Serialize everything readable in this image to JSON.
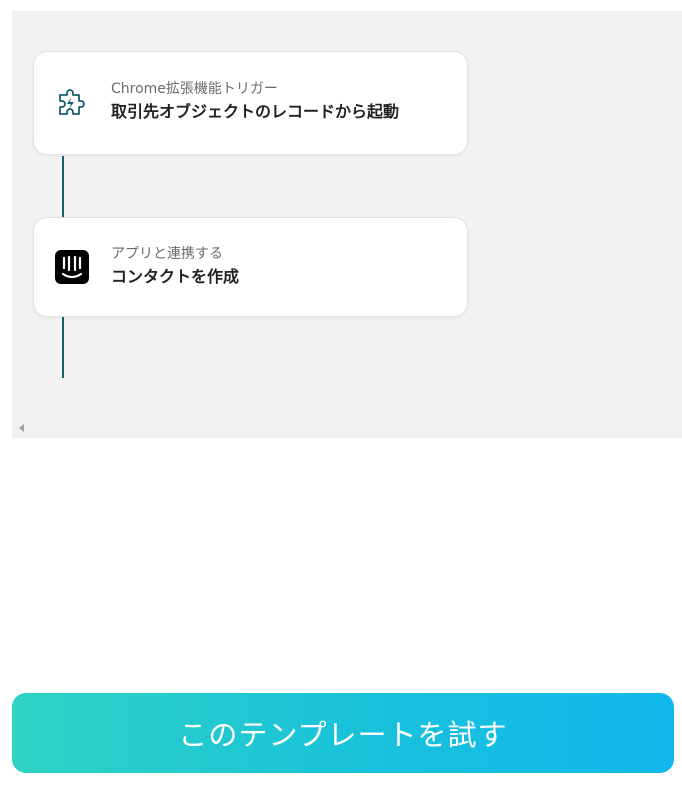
{
  "flow": {
    "steps": [
      {
        "icon": "puzzle-piece-icon",
        "subtitle": "Chrome拡張機能トリガー",
        "title": "取引先オブジェクトのレコードから起動"
      },
      {
        "icon": "intercom-logo-icon",
        "subtitle": "アプリと連携する",
        "title": "コンタクトを作成"
      }
    ]
  },
  "cta": {
    "label": "このテンプレートを試す"
  },
  "colors": {
    "canvas_bg": "#f2f2f2",
    "connector": "#1a5e74",
    "cta_gradient_start": "#2ed3c3",
    "cta_gradient_end": "#10b7ec"
  }
}
